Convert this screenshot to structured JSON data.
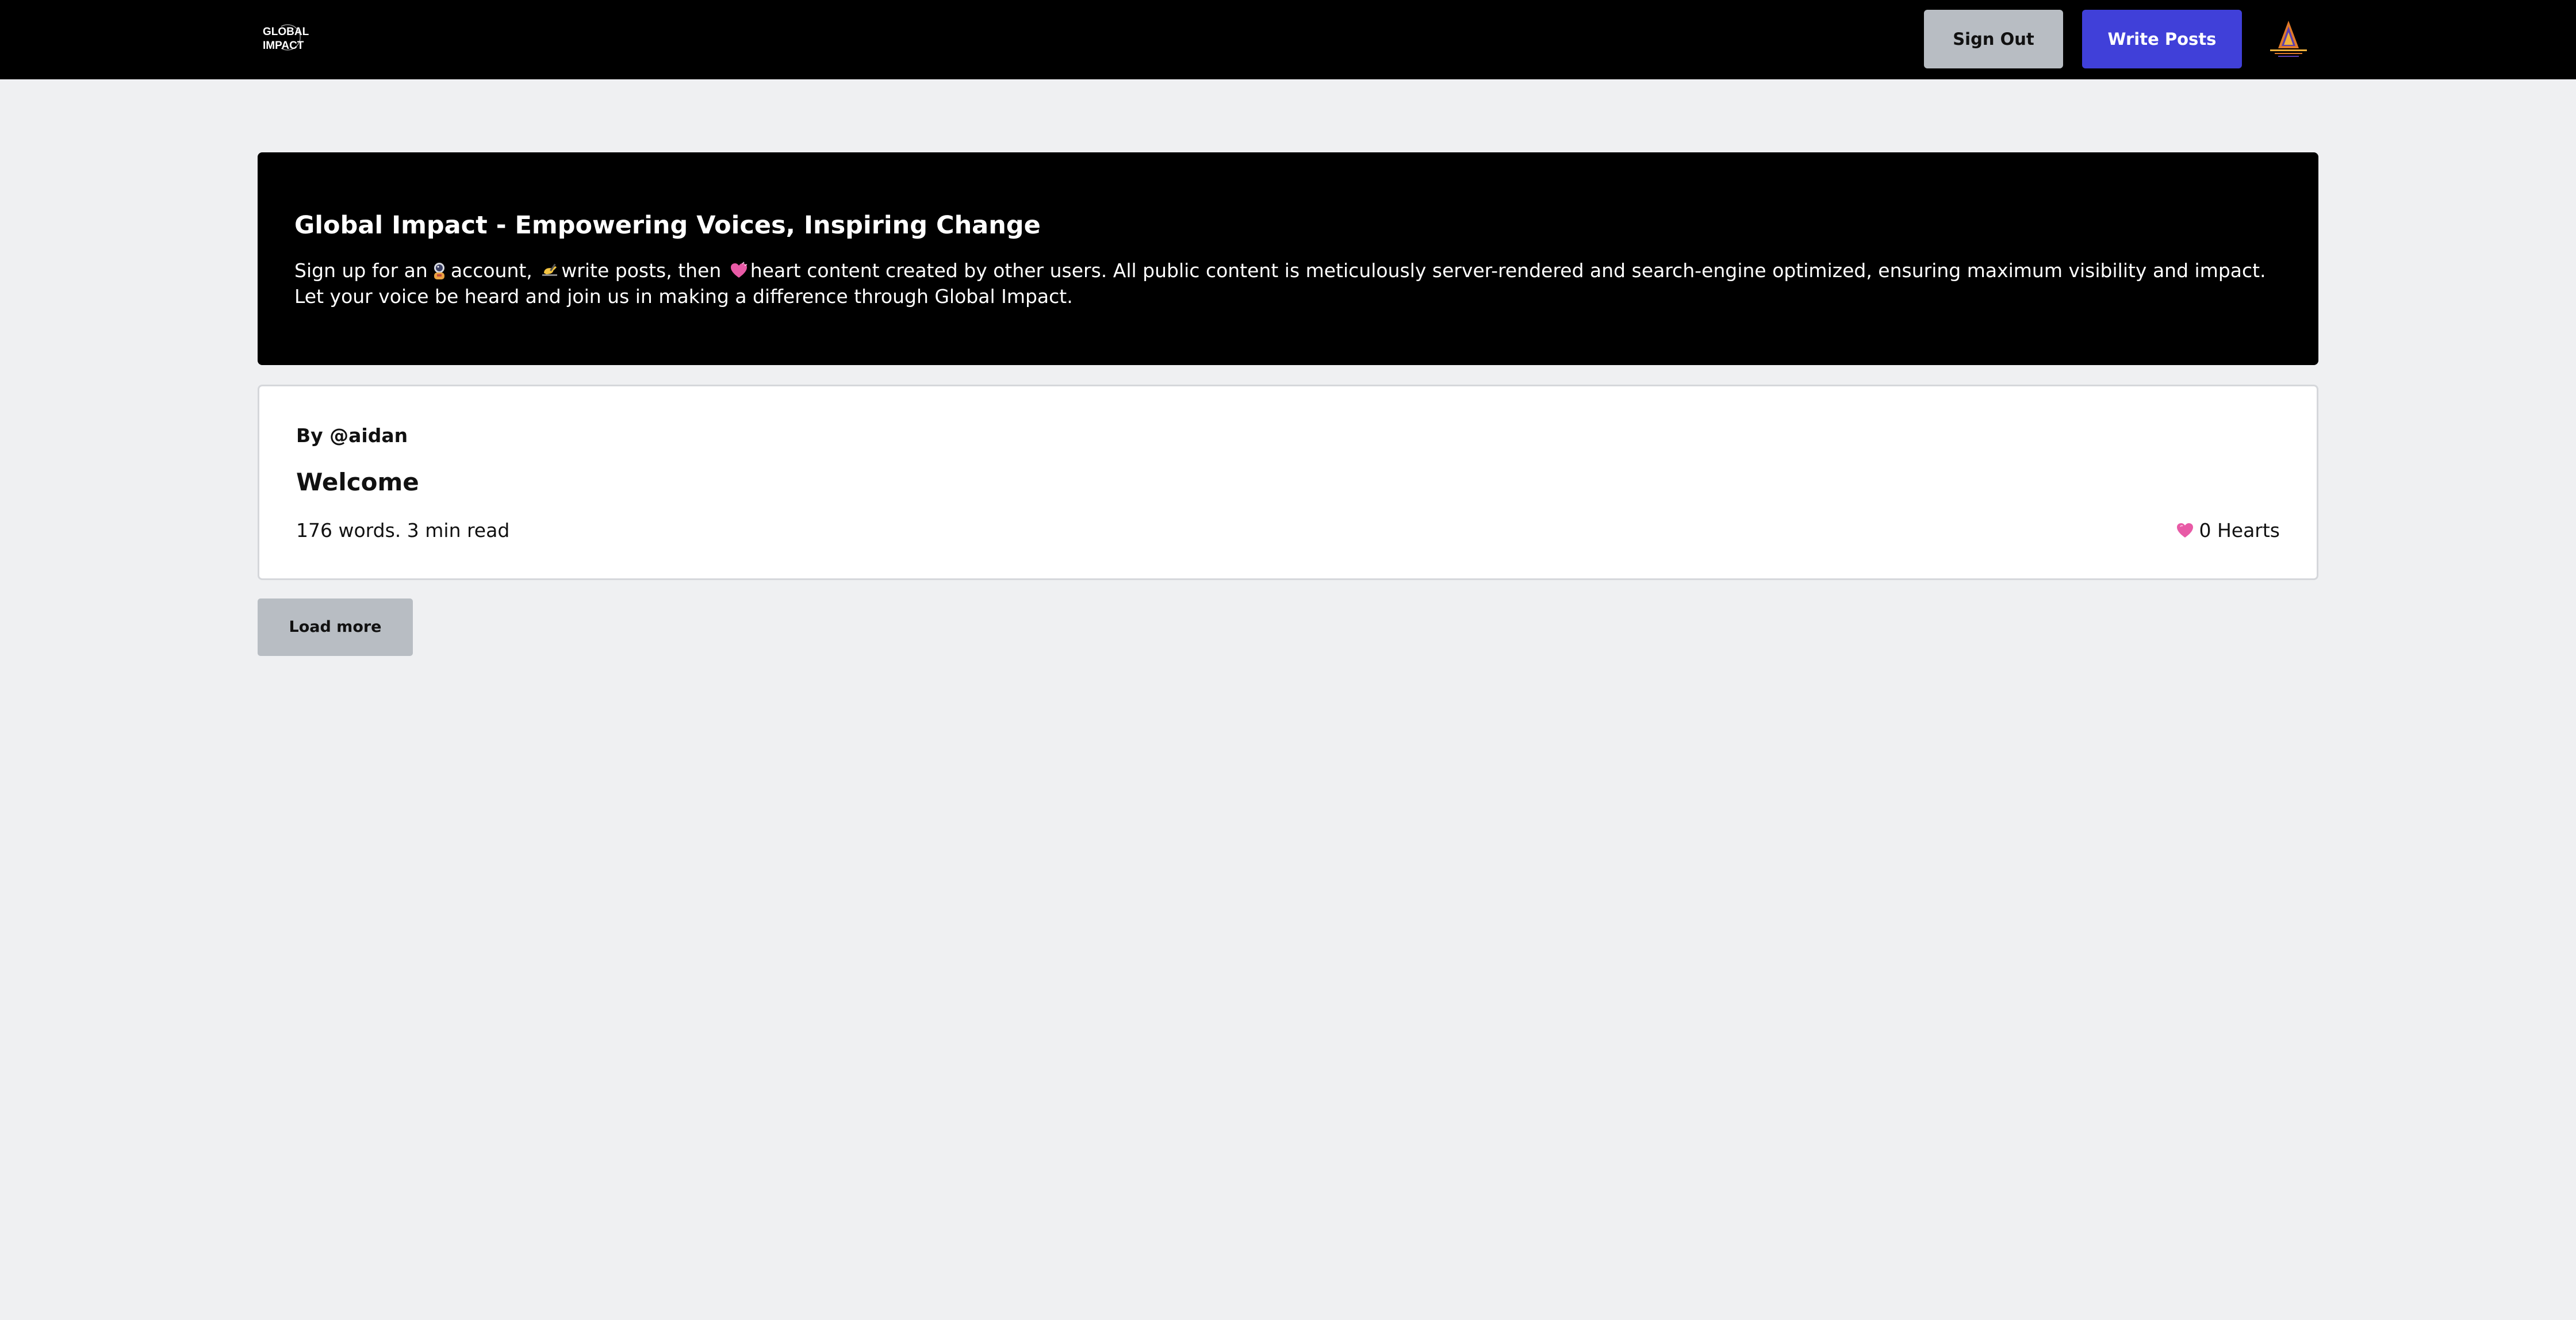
{
  "header": {
    "logo_icon": "global-impact-logo",
    "logo_line1": "GLOBAL",
    "logo_line2": "IMPACT",
    "sign_out_label": "Sign Out",
    "write_posts_label": "Write Posts",
    "avatar_icon": "user-avatar-icon"
  },
  "hero": {
    "title": "Global Impact - Empowering Voices, Inspiring Change",
    "text_part1": "Sign up for an",
    "icon1": "astronaut-icon",
    "text_part2": "account,",
    "icon2": "writing-hand-icon",
    "text_part3": "write posts, then",
    "icon3": "heart-icon",
    "text_part4": "heart content created by other users. All public content is meticulously server-rendered and search-engine optimized, ensuring maximum visibility and impact. Let your voice be heard and join us in making a difference through Global Impact."
  },
  "posts": [
    {
      "author": "By @aidan",
      "title": "Welcome",
      "meta": "176 words. 3 min read",
      "hearts_icon": "heart-icon",
      "hearts": "0 Hearts"
    }
  ],
  "load_more_label": "Load more",
  "colors": {
    "background": "#eff0f2",
    "navbar": "#000000",
    "primary": "#4040d9",
    "secondary": "#b8bdc3",
    "heart": "#e85aa6"
  }
}
